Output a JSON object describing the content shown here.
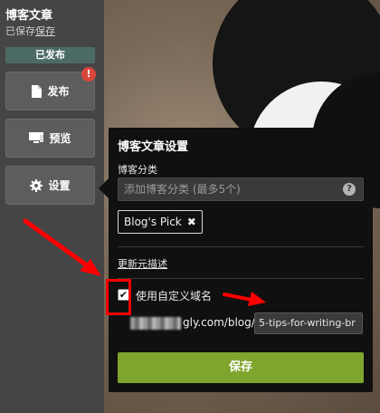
{
  "sidebar": {
    "title": "博客文章",
    "subtitle_prefix": "已保存",
    "subtitle_link": "保存",
    "status": "已发布",
    "buttons": [
      {
        "label": "发布",
        "icon": "document-icon",
        "alert": "!"
      },
      {
        "label": "预览",
        "icon": "monitor-icon"
      },
      {
        "label": "设置",
        "icon": "gear-icon"
      }
    ]
  },
  "settings": {
    "title": "博客文章设置",
    "category_label": "博客分类",
    "category_placeholder": "添加博客分类 (最多5个)",
    "help_icon": "?",
    "tags": [
      "Blog's Pick"
    ],
    "meta_link": "更新元描述",
    "custom_domain_label": "使用自定义域名",
    "custom_domain_checked": true,
    "url_suffix": "gly.com/blog/",
    "slug_value": "5-tips-for-writing-br",
    "save_label": "保存",
    "save_color": "#7fa52e"
  },
  "annotation_color": "#ff0000"
}
